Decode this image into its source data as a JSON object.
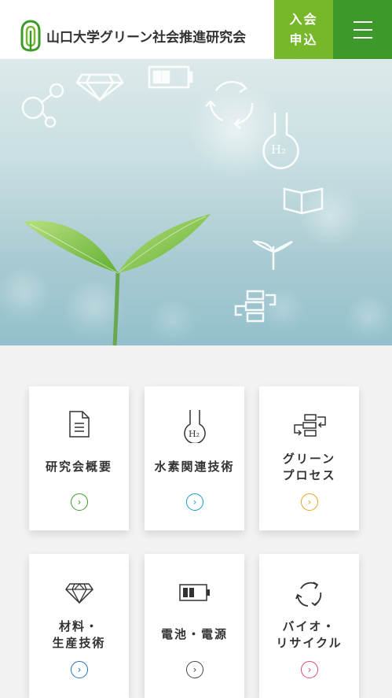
{
  "header": {
    "org_name": "山口大学グリーン社会推進研究会",
    "join_label_line1": "入会",
    "join_label_line2": "申込",
    "menu_icon": "hamburger-icon"
  },
  "hero": {
    "icons": [
      "molecule-icon",
      "diamond-icon",
      "battery-icon",
      "recycle-icon",
      "hydrogen-flask-icon",
      "book-icon",
      "sprout-icon",
      "process-icon"
    ],
    "flask_text": "H₂"
  },
  "cards": [
    {
      "line1": "研究会概要",
      "line2": "",
      "icon": "document-icon",
      "arrow_color": "#3d9a2a"
    },
    {
      "line1": "水素関連技術",
      "line2": "",
      "icon": "hydrogen-flask-icon",
      "arrow_color": "#1aa0c8"
    },
    {
      "line1": "グリーン",
      "line2": "プロセス",
      "icon": "process-icon",
      "arrow_color": "#e8a317"
    },
    {
      "line1": "材料・",
      "line2": "生産技術",
      "icon": "diamond-icon",
      "arrow_color": "#1b6fc9"
    },
    {
      "line1": "電池・電源",
      "line2": "",
      "icon": "battery-icon",
      "arrow_color": "#444444"
    },
    {
      "line1": "バイオ・",
      "line2": "リサイクル",
      "icon": "recycle-icon",
      "arrow_color": "#e0447f"
    }
  ],
  "arrow_glyph": "›"
}
